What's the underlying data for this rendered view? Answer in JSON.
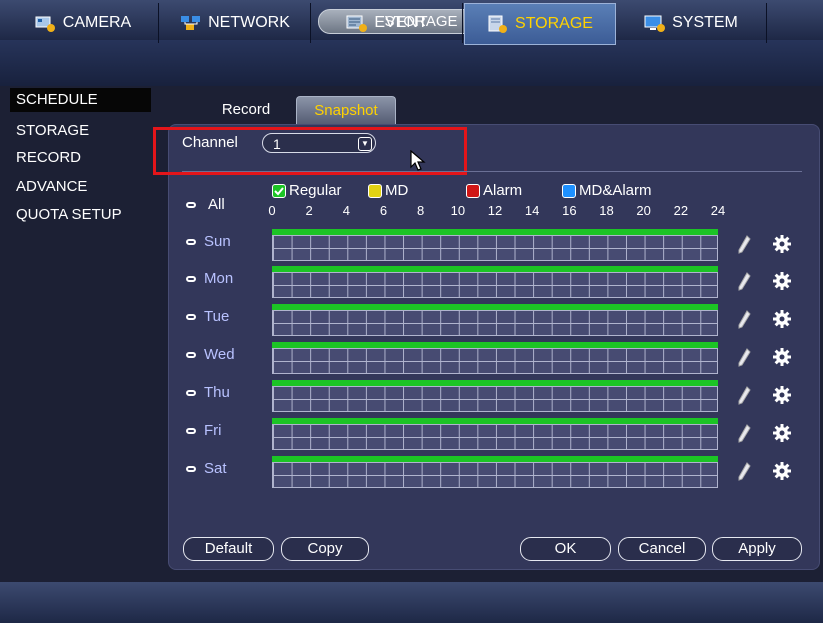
{
  "window": {
    "title": "STORAGE"
  },
  "nav": {
    "tabs": [
      {
        "label": "CAMERA",
        "icon": "camera-icon",
        "active": false
      },
      {
        "label": "NETWORK",
        "icon": "network-icon",
        "active": false
      },
      {
        "label": "EVENT",
        "icon": "event-icon",
        "active": false
      },
      {
        "label": "STORAGE",
        "icon": "storage-icon",
        "active": true
      },
      {
        "label": "SYSTEM",
        "icon": "system-icon",
        "active": false
      }
    ]
  },
  "sidebar": {
    "items": [
      {
        "label": "SCHEDULE",
        "active": true
      },
      {
        "label": "STORAGE",
        "active": false
      },
      {
        "label": "RECORD",
        "active": false
      },
      {
        "label": "ADVANCE",
        "active": false
      },
      {
        "label": "QUOTA SETUP",
        "active": false
      }
    ]
  },
  "subtabs": {
    "record": "Record",
    "snapshot": "Snapshot",
    "active": "Snapshot"
  },
  "channel": {
    "label": "Channel",
    "value": "1"
  },
  "legend": {
    "all_label": "All",
    "items": [
      {
        "label": "Regular",
        "color": "#1cc425",
        "checked": true
      },
      {
        "label": "MD",
        "color": "#e2d214",
        "checked": false
      },
      {
        "label": "Alarm",
        "color": "#d01616",
        "checked": false
      },
      {
        "label": "MD&Alarm",
        "color": "#1e90ff",
        "checked": false
      }
    ]
  },
  "hours": [
    "0",
    "2",
    "4",
    "6",
    "8",
    "10",
    "12",
    "14",
    "16",
    "18",
    "20",
    "22",
    "24"
  ],
  "days": [
    "Sun",
    "Mon",
    "Tue",
    "Wed",
    "Thu",
    "Fri",
    "Sat"
  ],
  "schedule": {
    "regular_coverage": "0-24 every day"
  },
  "buttons": {
    "default": "Default",
    "copy": "Copy",
    "ok": "OK",
    "cancel": "Cancel",
    "apply": "Apply"
  },
  "colors": {
    "accent_active_text": "#ffd200",
    "highlight_box": "#e3151a",
    "regular": "#1cc425"
  }
}
